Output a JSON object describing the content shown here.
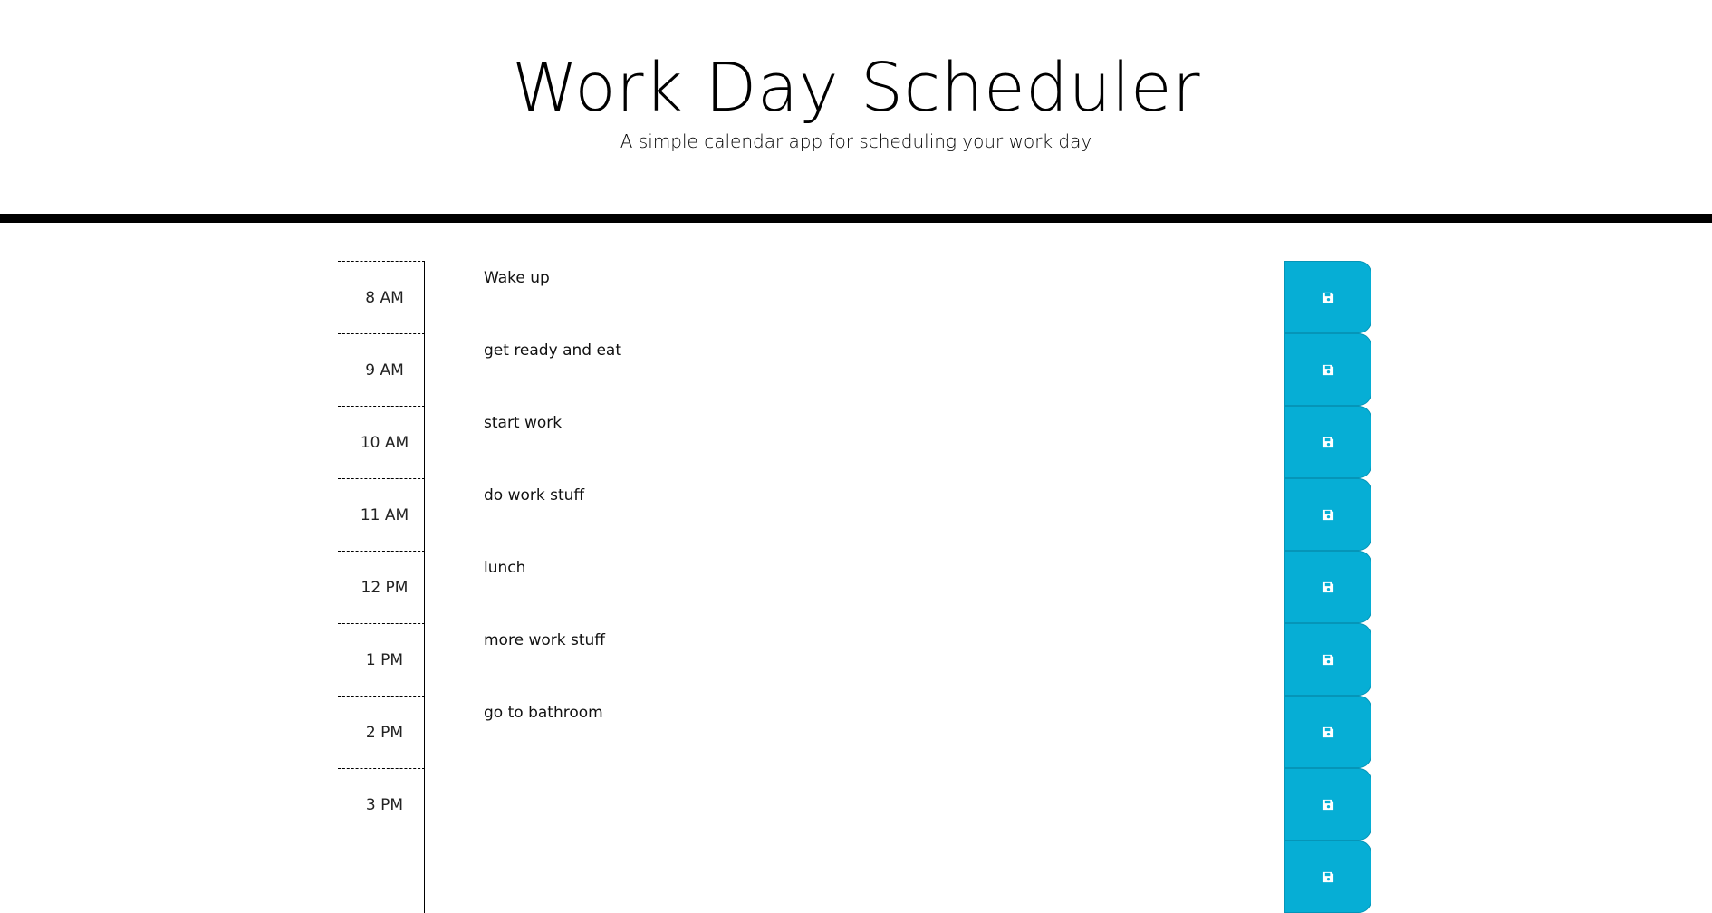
{
  "header": {
    "title": "Work Day Scheduler",
    "lead": "A simple calendar app for scheduling your work day"
  },
  "colors": {
    "save_button": "#06aed5",
    "header_rule": "#000000"
  },
  "icons": {
    "save": "floppy-disk-icon"
  },
  "timeblocks": [
    {
      "hour": "8 AM",
      "task": "Wake up"
    },
    {
      "hour": "9 AM",
      "task": "get ready and eat"
    },
    {
      "hour": "10 AM",
      "task": "start work"
    },
    {
      "hour": "11 AM",
      "task": "do work stuff"
    },
    {
      "hour": "12 PM",
      "task": "lunch"
    },
    {
      "hour": "1 PM",
      "task": "more work stuff"
    },
    {
      "hour": "2 PM",
      "task": "go to bathroom"
    },
    {
      "hour": "3 PM",
      "task": ""
    },
    {
      "hour": "",
      "task": ""
    }
  ]
}
